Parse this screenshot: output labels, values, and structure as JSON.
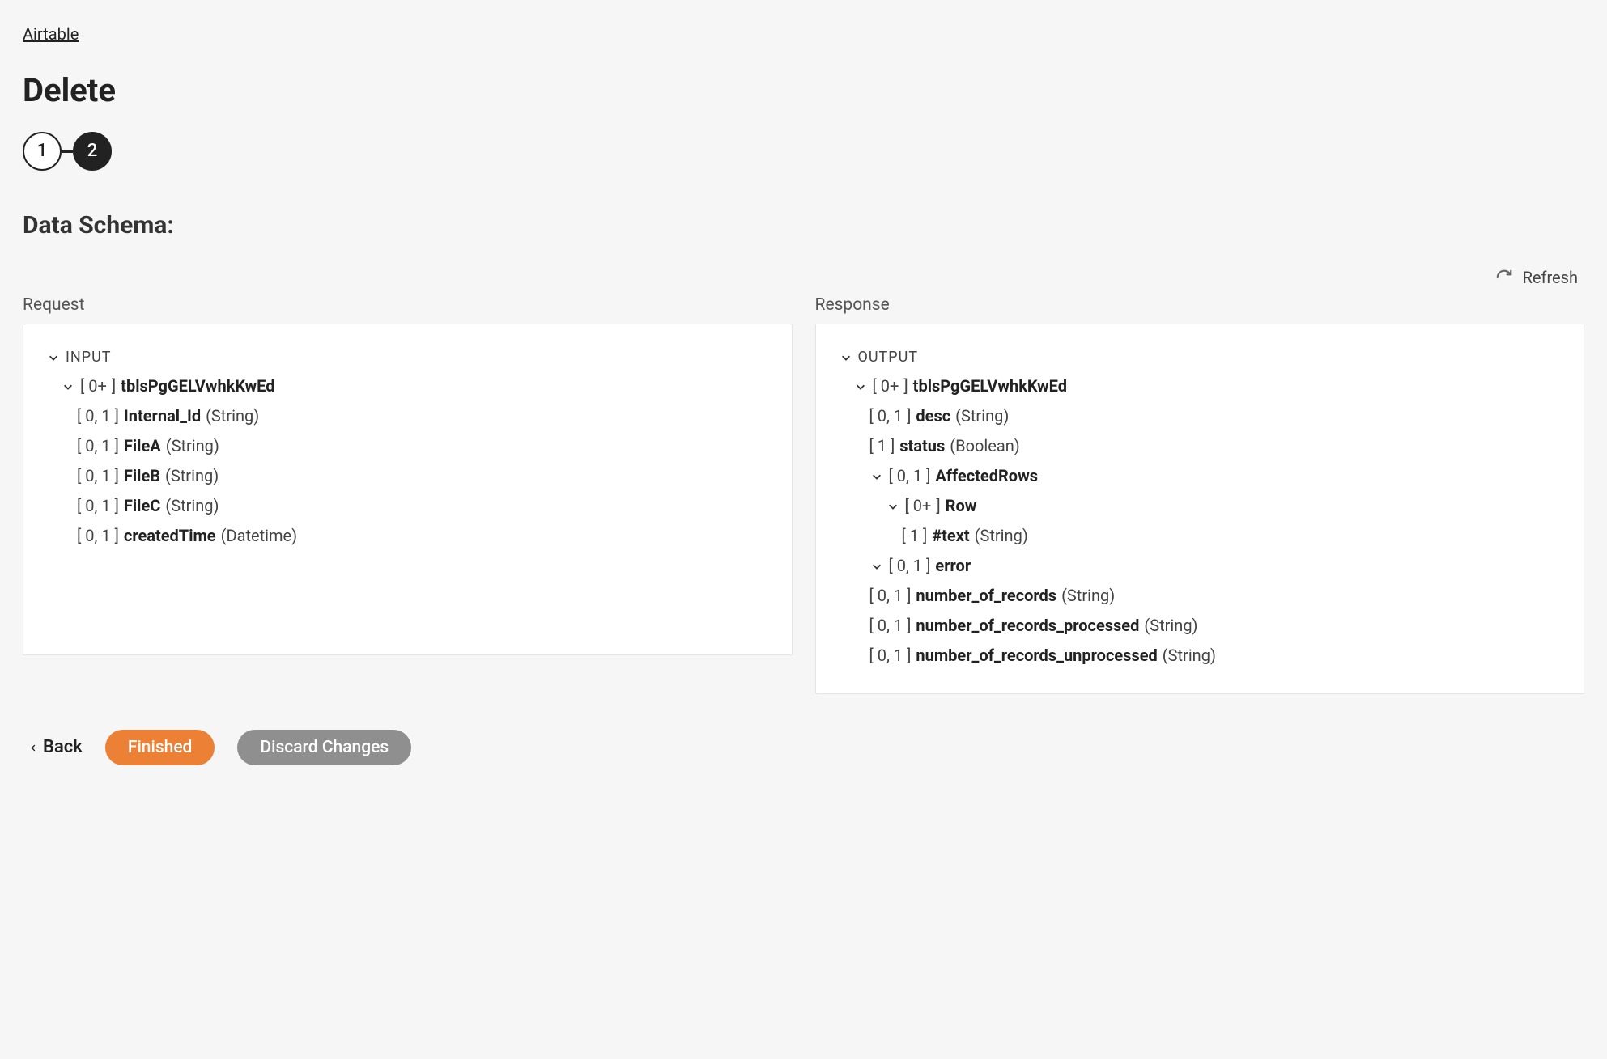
{
  "breadcrumb": "Airtable",
  "page_title": "Delete",
  "stepper": {
    "step1": "1",
    "step2": "2"
  },
  "section_title": "Data Schema:",
  "refresh_label": "Refresh",
  "request": {
    "label": "Request",
    "root": "INPUT",
    "table": {
      "card_prefix": "[ 0+",
      "card_suffix": " ] ",
      "name": "tblsPgGELVwhkKwEd"
    },
    "fields": [
      {
        "card": "[ 0, 1 ] ",
        "name": "Internal_Id",
        "type": " (String)"
      },
      {
        "card": "[ 0, 1 ] ",
        "name": "FileA",
        "type": " (String)"
      },
      {
        "card": "[ 0, 1 ] ",
        "name": "FileB",
        "type": " (String)"
      },
      {
        "card": "[ 0, 1 ] ",
        "name": "FileC",
        "type": " (String)"
      },
      {
        "card": "[ 0, 1 ] ",
        "name": "createdTime",
        "type": " (Datetime)"
      }
    ]
  },
  "response": {
    "label": "Response",
    "root": "OUTPUT",
    "table": {
      "card_prefix": "[ 0+",
      "card_suffix": " ] ",
      "name": "tblsPgGELVwhkKwEd"
    },
    "top_fields": [
      {
        "card": "[ 0, 1 ] ",
        "name": "desc",
        "type": " (String)"
      },
      {
        "card": "[ 1 ] ",
        "name": "status",
        "type": " (Boolean)"
      }
    ],
    "affected": {
      "card": "[ 0, 1 ] ",
      "name": "AffectedRows"
    },
    "row": {
      "card_prefix": "[ 0+",
      "card_suffix": " ] ",
      "name": "Row"
    },
    "row_field": {
      "card": "[ 1 ] ",
      "name": "#text",
      "type": " (String)"
    },
    "error": {
      "card": "[ 0, 1 ] ",
      "name": "error"
    },
    "error_fields": [
      {
        "card": "[ 0, 1 ] ",
        "name": "number_of_records",
        "type": " (String)"
      },
      {
        "card": "[ 0, 1 ] ",
        "name": "number_of_records_processed",
        "type": " (String)"
      },
      {
        "card": "[ 0, 1 ] ",
        "name": "number_of_records_unprocessed",
        "type": " (String)"
      }
    ]
  },
  "footer": {
    "back": "Back",
    "finished": "Finished",
    "discard": "Discard Changes"
  }
}
